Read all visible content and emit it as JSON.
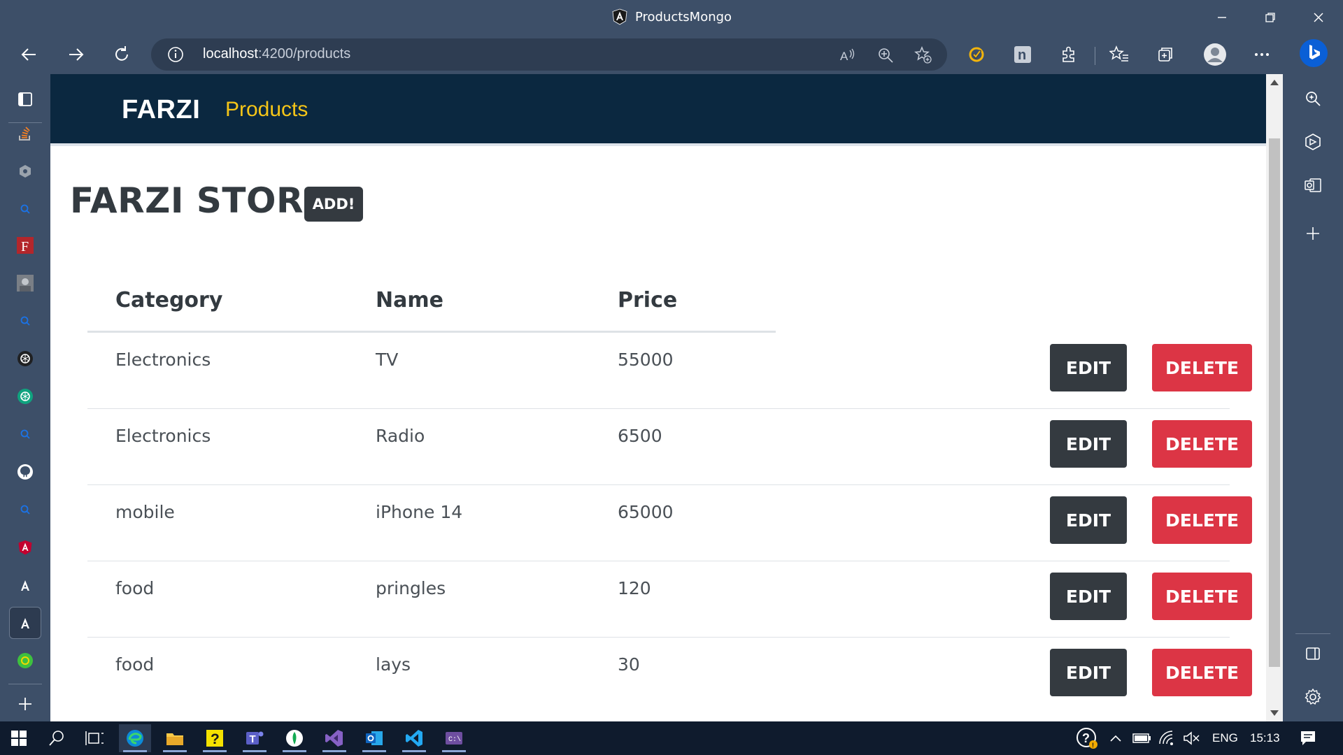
{
  "window": {
    "title": "ProductsMongo"
  },
  "browser": {
    "address_host": "localhost",
    "address_path": ":4200/products",
    "colors": {
      "frame": "#3d4f68",
      "address_bg": "#2e3d52"
    }
  },
  "app": {
    "brand": "FARZI",
    "nav_link": "Products",
    "page_title": "FARZI STORE",
    "add_button": "ADD!",
    "table": {
      "headers": [
        "Category",
        "Name",
        "Price"
      ],
      "rows": [
        {
          "category": "Electronics",
          "name": "TV",
          "price": "55000"
        },
        {
          "category": "Electronics",
          "name": "Radio",
          "price": "6500"
        },
        {
          "category": "mobile",
          "name": "iPhone 14",
          "price": "65000"
        },
        {
          "category": "food",
          "name": "pringles",
          "price": "120"
        },
        {
          "category": "food",
          "name": "lays",
          "price": "30"
        }
      ],
      "edit_label": "EDIT",
      "delete_label": "DELETE"
    },
    "colors": {
      "navbar": "#0b2840",
      "nav_link": "#f5c518",
      "edit": "#343a40",
      "delete": "#dc3545"
    }
  },
  "taskbar": {
    "language": "ENG",
    "time": "15:13"
  }
}
